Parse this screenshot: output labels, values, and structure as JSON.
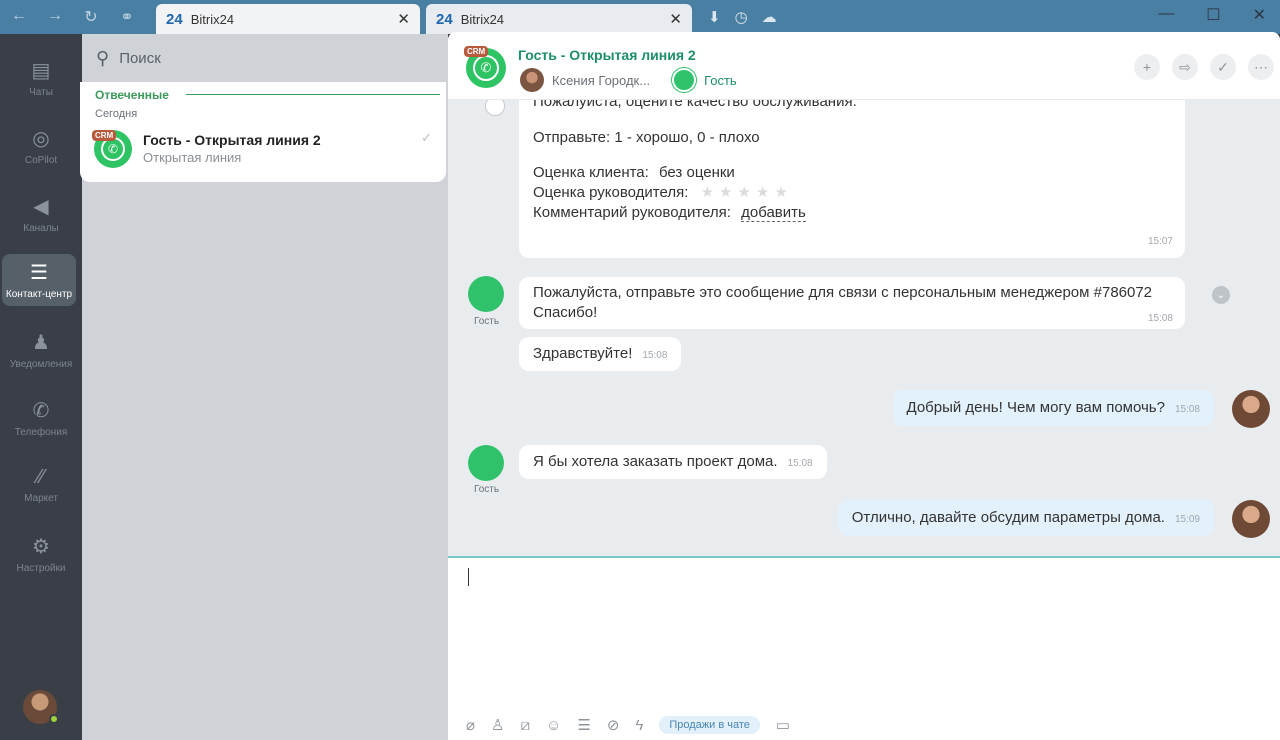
{
  "browser": {
    "tabs": [
      {
        "logo": "24",
        "label": "Bitrix24",
        "close": "✕"
      },
      {
        "logo": "24",
        "label": "Bitrix24",
        "close": "✕"
      }
    ]
  },
  "sidebar": {
    "items": [
      {
        "icon": "chats-icon",
        "label": "Чаты"
      },
      {
        "icon": "copilot-icon",
        "label": "CoPilot"
      },
      {
        "icon": "channels-icon",
        "label": "Каналы"
      },
      {
        "icon": "contact-center-icon",
        "label": "Контакт-центр"
      },
      {
        "icon": "bell-icon",
        "label": "Уведомления"
      },
      {
        "icon": "phone-icon",
        "label": "Телефония"
      },
      {
        "icon": "market-icon",
        "label": "Маркет"
      },
      {
        "icon": "gear-icon",
        "label": "Настройки"
      }
    ]
  },
  "list": {
    "search_placeholder": "Поиск",
    "section": "Отвеченные",
    "today": "Сегодня",
    "item": {
      "badge": "CRM",
      "title": "Гость - Открытая линия 2",
      "subtitle": "Открытая линия"
    }
  },
  "chat": {
    "title": "Гость - Открытая линия 2",
    "badge": "CRM",
    "members": [
      {
        "name": "Ксения Городк..."
      },
      {
        "name": "Гость"
      }
    ],
    "rating_message": {
      "line1": "Пожалуйста, оцените качество обслуживания.",
      "line2": "Отправьте: 1 - хорошо, 0 - плохо",
      "client_label": "Оценка клиента:",
      "client_value": "без оценки",
      "manager_label": "Оценка руководителя:",
      "comment_label": "Комментарий руководителя:",
      "comment_link": "добавить",
      "time": "15:07"
    },
    "messages": [
      {
        "text": "Пожалуйста, отправьте это сообщение для связи с персональным менеджером #786072 Спасибо!",
        "time": "15:08",
        "author": "Гость"
      },
      {
        "text": "Здравствуйте!",
        "time": "15:08"
      },
      {
        "text": "Добрый день! Чем могу вам помочь?",
        "time": "15:08"
      },
      {
        "text": "Я бы хотела заказать проект дома.",
        "time": "15:08",
        "author": "Гость"
      },
      {
        "text": "Отлично, давайте обсудим параметры дома.",
        "time": "15:09"
      }
    ]
  },
  "composer": {
    "sales_button": "Продажи в чате"
  }
}
